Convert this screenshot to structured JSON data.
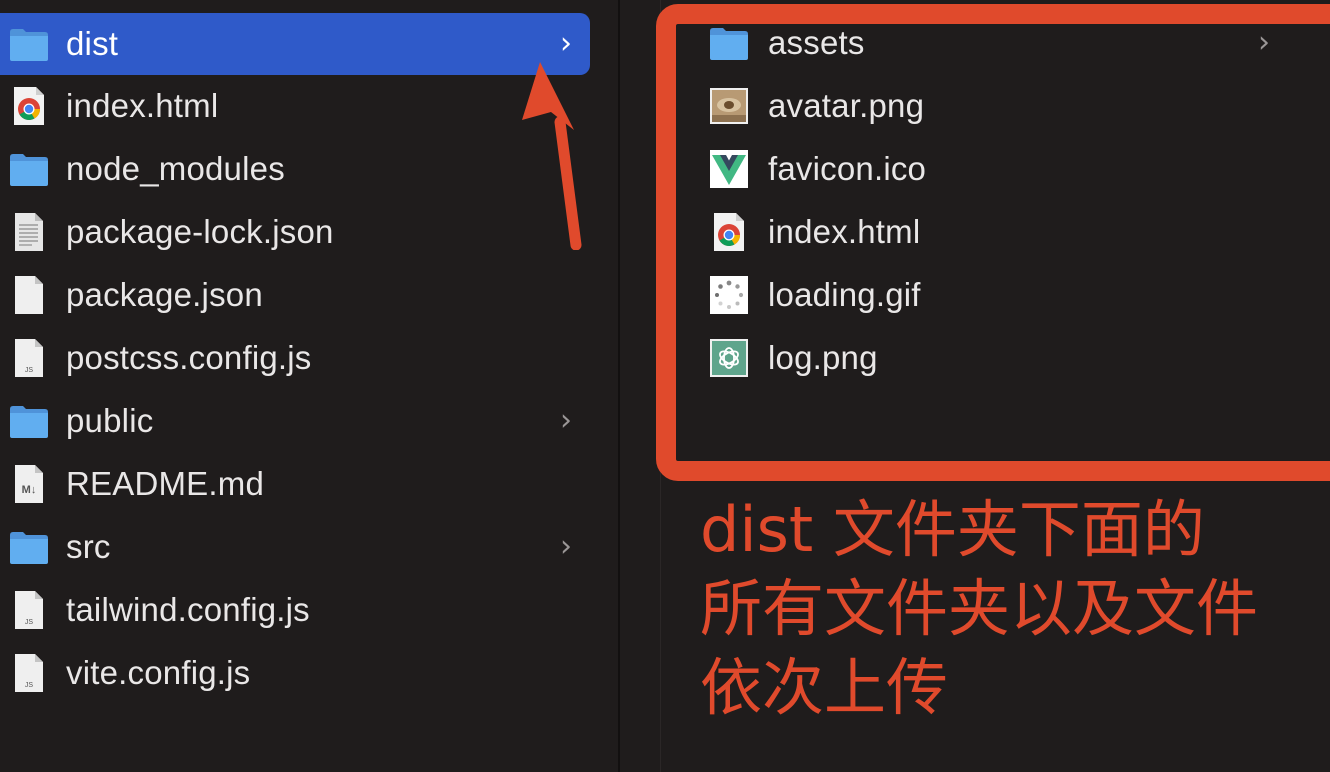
{
  "left_column": {
    "items": [
      {
        "label": "dist",
        "icon": "folder-icon",
        "has_chevron": true,
        "selected": true
      },
      {
        "label": "index.html",
        "icon": "chrome-html-icon",
        "has_chevron": false
      },
      {
        "label": "node_modules",
        "icon": "folder-icon",
        "has_chevron": false
      },
      {
        "label": "package-lock.json",
        "icon": "text-file-icon",
        "has_chevron": false
      },
      {
        "label": "package.json",
        "icon": "blank-file-icon",
        "has_chevron": false
      },
      {
        "label": "postcss.config.js",
        "icon": "js-file-icon",
        "has_chevron": false
      },
      {
        "label": "public",
        "icon": "folder-icon",
        "has_chevron": true
      },
      {
        "label": "README.md",
        "icon": "markdown-file-icon",
        "has_chevron": false
      },
      {
        "label": "src",
        "icon": "folder-icon",
        "has_chevron": true
      },
      {
        "label": "tailwind.config.js",
        "icon": "js-file-icon",
        "has_chevron": false
      },
      {
        "label": "vite.config.js",
        "icon": "js-file-icon",
        "has_chevron": false
      }
    ]
  },
  "right_column": {
    "items": [
      {
        "label": "assets",
        "icon": "folder-icon",
        "has_chevron": true
      },
      {
        "label": "avatar.png",
        "icon": "image-thumbnail-icon",
        "has_chevron": false
      },
      {
        "label": "favicon.ico",
        "icon": "vue-logo-icon",
        "has_chevron": false
      },
      {
        "label": "index.html",
        "icon": "chrome-html-icon",
        "has_chevron": false
      },
      {
        "label": "loading.gif",
        "icon": "loading-spinner-icon",
        "has_chevron": false
      },
      {
        "label": "log.png",
        "icon": "chatgpt-logo-icon",
        "has_chevron": false
      }
    ]
  },
  "chevron_glyph": "›",
  "annotation": {
    "lines": [
      "dist 文件夹下面的",
      "所有文件夹以及文件",
      "依次上传"
    ],
    "color": "#e04a2c"
  },
  "colors": {
    "background": "#1f1c1c",
    "selection": "#2f5ac9",
    "folder_blue": "#5aa3e8",
    "annotation_red": "#e04a2c"
  }
}
